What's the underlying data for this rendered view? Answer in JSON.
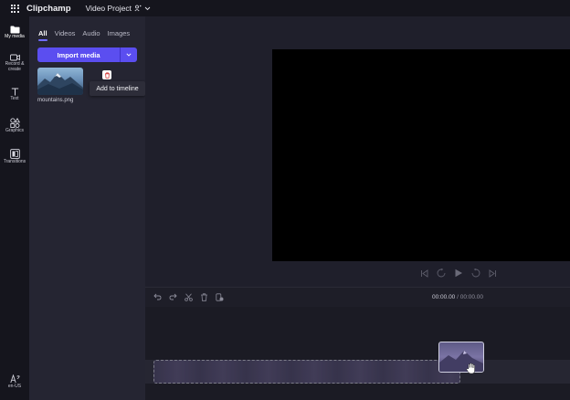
{
  "app": {
    "brand": "Clipchamp",
    "project_title": "Video Project"
  },
  "rail": {
    "items": [
      {
        "label": "My media",
        "icon": "folder-icon",
        "active": true
      },
      {
        "label": "Record & create",
        "icon": "camera-icon",
        "active": false
      },
      {
        "label": "Text",
        "icon": "text-icon",
        "active": false
      },
      {
        "label": "Graphics",
        "icon": "shapes-icon",
        "active": false
      },
      {
        "label": "Transitions",
        "icon": "transitions-icon",
        "active": false
      }
    ],
    "language": "en-US"
  },
  "media_panel": {
    "tabs": [
      {
        "label": "All",
        "active": true
      },
      {
        "label": "Videos",
        "active": false
      },
      {
        "label": "Audio",
        "active": false
      },
      {
        "label": "Images",
        "active": false
      }
    ],
    "import_label": "Import media",
    "asset_name": "mountains.png",
    "tooltip": "Add to timeline"
  },
  "timeline": {
    "current_time": "00:00.00",
    "separator": " / ",
    "total_time": "00:00.00"
  },
  "colors": {
    "accent": "#5b4ef0",
    "add_green": "#2ad39f",
    "background": "#1f1f2b",
    "panel": "#252532"
  }
}
